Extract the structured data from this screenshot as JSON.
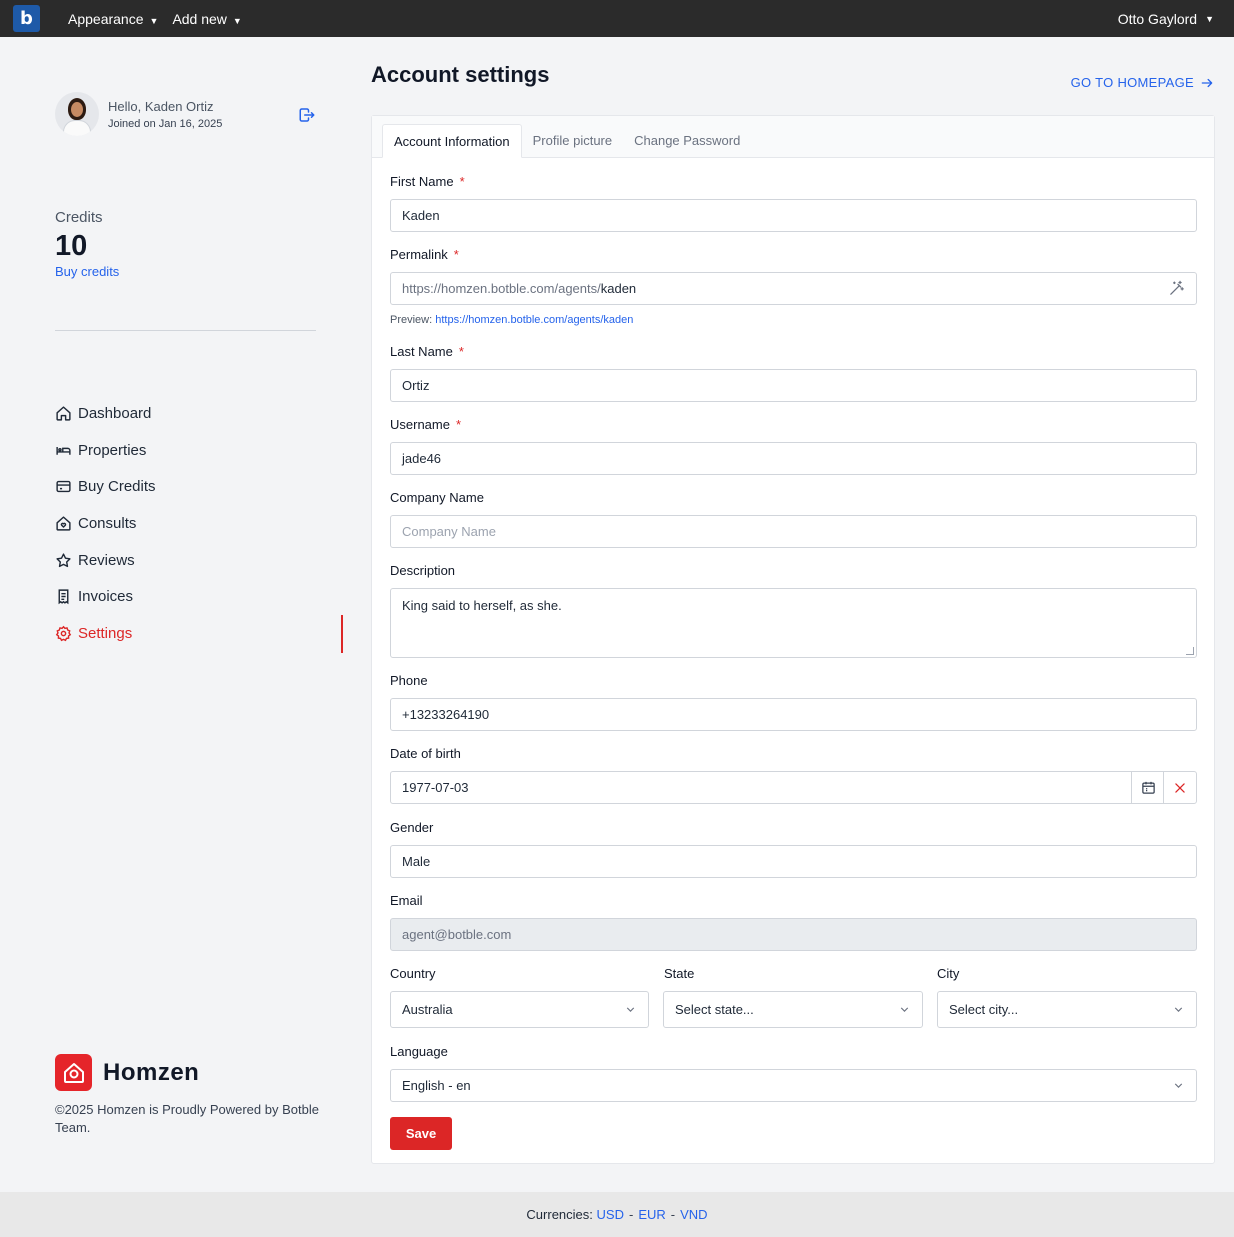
{
  "topbar": {
    "logo_letter": "b",
    "menu": [
      {
        "label": "Appearance"
      },
      {
        "label": "Add new"
      }
    ],
    "user_name": "Otto Gaylord"
  },
  "sidebar": {
    "greeting": "Hello, Kaden Ortiz",
    "joined": "Joined on Jan 16, 2025",
    "credits_label": "Credits",
    "credits_value": "10",
    "buy_credits": "Buy credits",
    "nav": [
      {
        "label": "Dashboard",
        "icon": "home-icon"
      },
      {
        "label": "Properties",
        "icon": "bed-icon"
      },
      {
        "label": "Buy Credits",
        "icon": "credit-card-icon"
      },
      {
        "label": "Consults",
        "icon": "house-heart-icon"
      },
      {
        "label": "Reviews",
        "icon": "star-icon"
      },
      {
        "label": "Invoices",
        "icon": "receipt-icon"
      },
      {
        "label": "Settings",
        "icon": "settings-icon",
        "active": true
      }
    ],
    "brand_name": "Homzen",
    "copyright": "©2025 Homzen is Proudly Powered by Botble Team."
  },
  "main": {
    "title": "Account settings",
    "home_link": "GO TO HOMEPAGE",
    "tabs": [
      {
        "label": "Account Information",
        "active": true
      },
      {
        "label": "Profile picture"
      },
      {
        "label": "Change Password"
      }
    ],
    "form": {
      "first_name_label": "First Name",
      "first_name": "Kaden",
      "permalink_label": "Permalink",
      "permalink_prefix": "https://homzen.botble.com/agents/",
      "permalink_slug": "kaden",
      "preview_label": "Preview:",
      "preview_url": "https://homzen.botble.com/agents/kaden",
      "last_name_label": "Last Name",
      "last_name": "Ortiz",
      "username_label": "Username",
      "username": "jade46",
      "company_label": "Company Name",
      "company_placeholder": "Company Name",
      "description_label": "Description",
      "description": "King said to herself, as she.",
      "phone_label": "Phone",
      "phone": "+13233264190",
      "dob_label": "Date of birth",
      "dob": "1977-07-03",
      "gender_label": "Gender",
      "gender": "Male",
      "email_label": "Email",
      "email": "agent@botble.com",
      "country_label": "Country",
      "country": "Australia",
      "state_label": "State",
      "state": "Select state...",
      "city_label": "City",
      "city": "Select city...",
      "language_label": "Language",
      "language": "English - en",
      "save": "Save",
      "required_mark": "*"
    }
  },
  "footer": {
    "label": "Currencies:",
    "currencies": [
      "USD",
      "EUR",
      "VND"
    ],
    "separator": "-"
  },
  "colors": {
    "accent": "#dc2626",
    "link": "#2563eb",
    "topbar": "#2b2b2b"
  }
}
